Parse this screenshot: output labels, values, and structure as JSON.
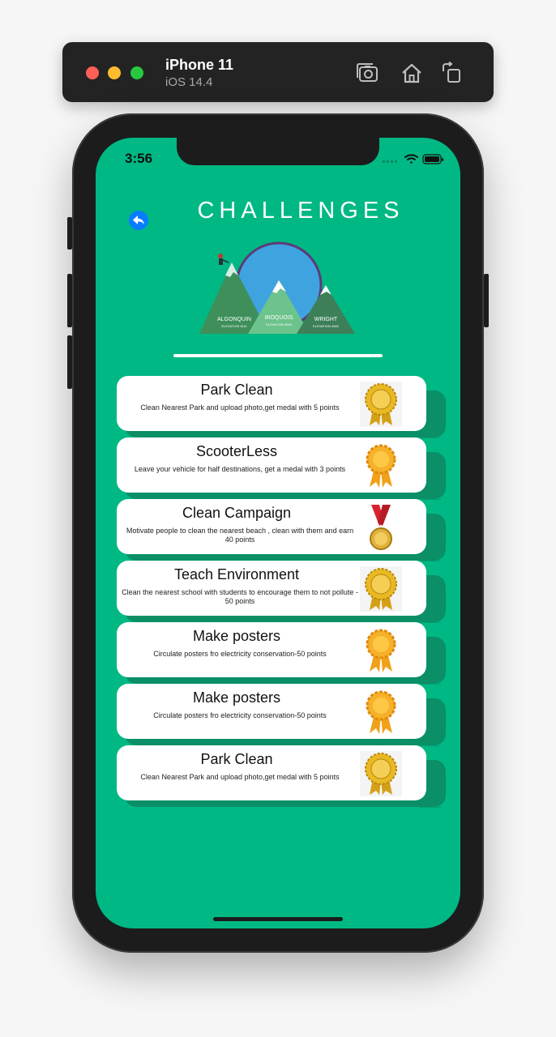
{
  "simulator": {
    "device_name": "iPhone 11",
    "os_version": "iOS 14.4",
    "toolbar_icons": [
      "camera-screenshot-icon",
      "home-icon",
      "rotate-icon"
    ]
  },
  "status_bar": {
    "time": "3:56"
  },
  "header": {
    "title": "CHALLENGES"
  },
  "logo": {
    "labels": [
      {
        "name": "ALGONQUIN",
        "sub": "ELEVATION 5111"
      },
      {
        "name": "IROQUOIS",
        "sub": "ELEVATION 4840"
      },
      {
        "name": "WRIGHT",
        "sub": "ELEVATION 4580"
      }
    ]
  },
  "colors": {
    "screen_bg": "#00b884",
    "card_bg": "#ffffff",
    "back_button": "#0a7cff"
  },
  "challenges": [
    {
      "title": "Park Clean",
      "description": "Clean Nearest Park and upload photo,get medal with 5 points",
      "medal": "gold-rosette-badge-icon"
    },
    {
      "title": "ScooterLess",
      "description": "Leave your vehicle for half destinations, get a medal with 3 points",
      "medal": "orange-rosette-ribbon-icon"
    },
    {
      "title": "Clean Campaign",
      "description": "Motivate people to clean the nearest beach , clean with them and earn 40 points",
      "medal": "gold-medal-red-ribbon-icon"
    },
    {
      "title": "Teach Environment",
      "description": "Clean the nearest school with students to encourage them to not pollute - 50 points",
      "medal": "gold-rosette-badge-icon"
    },
    {
      "title": "Make posters",
      "description": "Circulate posters fro electricity conservation-50 points",
      "medal": "orange-rosette-ribbon-icon"
    },
    {
      "title": "Make posters",
      "description": "Circulate posters fro electricity conservation-50 points",
      "medal": "orange-rosette-ribbon-icon"
    },
    {
      "title": "Park Clean",
      "description": "Clean Nearest Park and upload photo,get medal with 5 points",
      "medal": "gold-rosette-badge-icon"
    }
  ]
}
